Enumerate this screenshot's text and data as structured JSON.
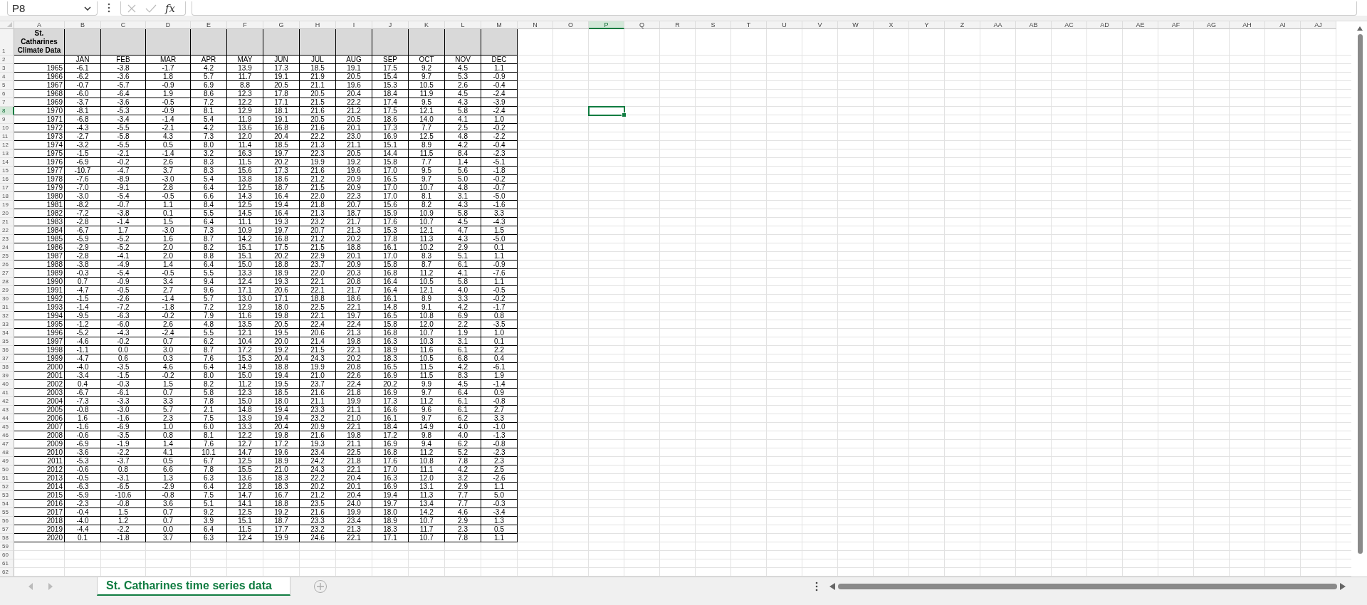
{
  "formula_bar": {
    "name_box": "P8",
    "function_label": "fx"
  },
  "columns": [
    {
      "label": "A",
      "selected": false
    },
    {
      "label": "B",
      "selected": false
    },
    {
      "label": "C",
      "selected": false
    },
    {
      "label": "D",
      "selected": false
    },
    {
      "label": "E",
      "selected": false
    },
    {
      "label": "F",
      "selected": false
    },
    {
      "label": "G",
      "selected": false
    },
    {
      "label": "H",
      "selected": false
    },
    {
      "label": "I",
      "selected": false
    },
    {
      "label": "J",
      "selected": false
    },
    {
      "label": "K",
      "selected": false
    },
    {
      "label": "L",
      "selected": false
    },
    {
      "label": "M",
      "selected": false
    },
    {
      "label": "N",
      "selected": false
    },
    {
      "label": "O",
      "selected": false
    },
    {
      "label": "P",
      "selected": true
    },
    {
      "label": "Q",
      "selected": false
    },
    {
      "label": "R",
      "selected": false
    },
    {
      "label": "S",
      "selected": false
    },
    {
      "label": "T",
      "selected": false
    },
    {
      "label": "U",
      "selected": false
    },
    {
      "label": "V",
      "selected": false
    },
    {
      "label": "W",
      "selected": false
    },
    {
      "label": "X",
      "selected": false
    },
    {
      "label": "Y",
      "selected": false
    },
    {
      "label": "Z",
      "selected": false
    },
    {
      "label": "AA",
      "selected": false
    },
    {
      "label": "AB",
      "selected": false
    },
    {
      "label": "AC",
      "selected": false
    },
    {
      "label": "AD",
      "selected": false
    },
    {
      "label": "AE",
      "selected": false
    },
    {
      "label": "AF",
      "selected": false
    },
    {
      "label": "AG",
      "selected": false
    },
    {
      "label": "AH",
      "selected": false
    },
    {
      "label": "AI",
      "selected": false
    },
    {
      "label": "AJ",
      "selected": false
    }
  ],
  "row_headers": [
    {
      "label": "1",
      "selected": false
    },
    {
      "label": "2",
      "selected": false
    },
    {
      "label": "3",
      "selected": false
    },
    {
      "label": "4",
      "selected": false
    },
    {
      "label": "5",
      "selected": false
    },
    {
      "label": "6",
      "selected": false
    },
    {
      "label": "7",
      "selected": false
    },
    {
      "label": "8",
      "selected": true
    },
    {
      "label": "9",
      "selected": false
    },
    {
      "label": "10",
      "selected": false
    },
    {
      "label": "11",
      "selected": false
    },
    {
      "label": "12",
      "selected": false
    },
    {
      "label": "13",
      "selected": false
    },
    {
      "label": "14",
      "selected": false
    },
    {
      "label": "15",
      "selected": false
    },
    {
      "label": "16",
      "selected": false
    },
    {
      "label": "17",
      "selected": false
    },
    {
      "label": "18",
      "selected": false
    },
    {
      "label": "19",
      "selected": false
    },
    {
      "label": "20",
      "selected": false
    },
    {
      "label": "21",
      "selected": false
    },
    {
      "label": "22",
      "selected": false
    },
    {
      "label": "23",
      "selected": false
    },
    {
      "label": "24",
      "selected": false
    },
    {
      "label": "25",
      "selected": false
    },
    {
      "label": "26",
      "selected": false
    },
    {
      "label": "27",
      "selected": false
    },
    {
      "label": "28",
      "selected": false
    },
    {
      "label": "29",
      "selected": false
    },
    {
      "label": "30",
      "selected": false
    },
    {
      "label": "31",
      "selected": false
    },
    {
      "label": "32",
      "selected": false
    },
    {
      "label": "33",
      "selected": false
    },
    {
      "label": "34",
      "selected": false
    },
    {
      "label": "35",
      "selected": false
    },
    {
      "label": "36",
      "selected": false
    },
    {
      "label": "37",
      "selected": false
    },
    {
      "label": "38",
      "selected": false
    },
    {
      "label": "39",
      "selected": false
    },
    {
      "label": "40",
      "selected": false
    },
    {
      "label": "41",
      "selected": false
    },
    {
      "label": "42",
      "selected": false
    },
    {
      "label": "43",
      "selected": false
    },
    {
      "label": "44",
      "selected": false
    },
    {
      "label": "45",
      "selected": false
    },
    {
      "label": "46",
      "selected": false
    },
    {
      "label": "47",
      "selected": false
    },
    {
      "label": "48",
      "selected": false
    },
    {
      "label": "49",
      "selected": false
    },
    {
      "label": "50",
      "selected": false
    },
    {
      "label": "51",
      "selected": false
    },
    {
      "label": "52",
      "selected": false
    },
    {
      "label": "53",
      "selected": false
    },
    {
      "label": "54",
      "selected": false
    },
    {
      "label": "55",
      "selected": false
    },
    {
      "label": "56",
      "selected": false
    },
    {
      "label": "57",
      "selected": false
    },
    {
      "label": "58",
      "selected": false
    },
    {
      "label": "59",
      "selected": false
    },
    {
      "label": "60",
      "selected": false
    },
    {
      "label": "61",
      "selected": false
    },
    {
      "label": "62",
      "selected": false
    }
  ],
  "table": {
    "title": "St. Catharines Climate Data",
    "months": [
      "JAN",
      "FEB",
      "MAR",
      "APR",
      "MAY",
      "JUN",
      "JUL",
      "AUG",
      "SEP",
      "OCT",
      "NOV",
      "DEC"
    ],
    "rows": [
      {
        "year": "1965",
        "values": [
          "-6.1",
          "-3.8",
          "-1.7",
          "4.2",
          "13.9",
          "17.3",
          "18.5",
          "19.1",
          "17.5",
          "9.2",
          "4.5",
          "1.1"
        ]
      },
      {
        "year": "1966",
        "values": [
          "-6.2",
          "-3.6",
          "1.8",
          "5.7",
          "11.7",
          "19.1",
          "21.9",
          "20.5",
          "15.4",
          "9.7",
          "5.3",
          "-0.9"
        ]
      },
      {
        "year": "1967",
        "values": [
          "-0.7",
          "-5.7",
          "-0.9",
          "6.9",
          "8.8",
          "20.5",
          "21.1",
          "19.6",
          "15.3",
          "10.5",
          "2.6",
          "-0.4"
        ]
      },
      {
        "year": "1968",
        "values": [
          "-6.0",
          "-6.4",
          "1.9",
          "8.6",
          "12.3",
          "17.8",
          "20.5",
          "20.4",
          "18.4",
          "11.9",
          "4.5",
          "-2.4"
        ]
      },
      {
        "year": "1969",
        "values": [
          "-3.7",
          "-3.6",
          "-0.5",
          "7.2",
          "12.2",
          "17.1",
          "21.5",
          "22.2",
          "17.4",
          "9.5",
          "4.3",
          "-3.9"
        ]
      },
      {
        "year": "1970",
        "values": [
          "-8.1",
          "-5.3",
          "-0.9",
          "8.1",
          "12.9",
          "18.1",
          "21.6",
          "21.2",
          "17.5",
          "12.1",
          "5.8",
          "-2.4"
        ]
      },
      {
        "year": "1971",
        "values": [
          "-6.8",
          "-3.4",
          "-1.4",
          "5.4",
          "11.9",
          "19.1",
          "20.5",
          "20.5",
          "18.6",
          "14.0",
          "4.1",
          "1.0"
        ]
      },
      {
        "year": "1972",
        "values": [
          "-4.3",
          "-5.5",
          "-2.1",
          "4.2",
          "13.6",
          "16.8",
          "21.6",
          "20.1",
          "17.3",
          "7.7",
          "2.5",
          "-0.2"
        ]
      },
      {
        "year": "1973",
        "values": [
          "-2.7",
          "-5.8",
          "4.3",
          "7.3",
          "12.0",
          "20.4",
          "22.2",
          "23.0",
          "16.9",
          "12.5",
          "4.8",
          "-2.2"
        ]
      },
      {
        "year": "1974",
        "values": [
          "-3.2",
          "-5.5",
          "0.5",
          "8.0",
          "11.4",
          "18.5",
          "21.3",
          "21.1",
          "15.1",
          "8.9",
          "4.2",
          "-0.4"
        ]
      },
      {
        "year": "1975",
        "values": [
          "-1.5",
          "-2.1",
          "-1.4",
          "3.2",
          "16.3",
          "19.7",
          "22.3",
          "20.5",
          "14.4",
          "11.5",
          "8.4",
          "-2.3"
        ]
      },
      {
        "year": "1976",
        "values": [
          "-6.9",
          "-0.2",
          "2.6",
          "8.3",
          "11.5",
          "20.2",
          "19.9",
          "19.2",
          "15.8",
          "7.7",
          "1.4",
          "-5.1"
        ]
      },
      {
        "year": "1977",
        "values": [
          "-10.7",
          "-4.7",
          "3.7",
          "8.3",
          "15.6",
          "17.3",
          "21.6",
          "19.6",
          "17.0",
          "9.5",
          "5.6",
          "-1.8"
        ]
      },
      {
        "year": "1978",
        "values": [
          "-7.6",
          "-8.9",
          "-3.0",
          "5.4",
          "13.8",
          "18.6",
          "21.2",
          "20.9",
          "16.5",
          "9.7",
          "5.0",
          "-0.2"
        ]
      },
      {
        "year": "1979",
        "values": [
          "-7.0",
          "-9.1",
          "2.8",
          "6.4",
          "12.5",
          "18.7",
          "21.5",
          "20.9",
          "17.0",
          "10.7",
          "4.8",
          "-0.7"
        ]
      },
      {
        "year": "1980",
        "values": [
          "-3.0",
          "-5.4",
          "-0.5",
          "6.6",
          "14.3",
          "16.4",
          "22.0",
          "22.3",
          "17.0",
          "8.1",
          "3.1",
          "-5.0"
        ]
      },
      {
        "year": "1981",
        "values": [
          "-8.2",
          "-0.7",
          "1.1",
          "8.4",
          "12.5",
          "19.4",
          "21.8",
          "20.7",
          "15.6",
          "8.2",
          "4.3",
          "-1.6"
        ]
      },
      {
        "year": "1982",
        "values": [
          "-7.2",
          "-3.8",
          "0.1",
          "5.5",
          "14.5",
          "16.4",
          "21.3",
          "18.7",
          "15.9",
          "10.9",
          "5.8",
          "3.3"
        ]
      },
      {
        "year": "1983",
        "values": [
          "-2.8",
          "-1.4",
          "1.5",
          "6.4",
          "11.1",
          "19.3",
          "23.2",
          "21.7",
          "17.6",
          "10.7",
          "4.5",
          "-4.3"
        ]
      },
      {
        "year": "1984",
        "values": [
          "-6.7",
          "1.7",
          "-3.0",
          "7.3",
          "10.9",
          "19.7",
          "20.7",
          "21.3",
          "15.3",
          "12.1",
          "4.7",
          "1.5"
        ]
      },
      {
        "year": "1985",
        "values": [
          "-5.9",
          "-5.2",
          "1.6",
          "8.7",
          "14.2",
          "16.8",
          "21.2",
          "20.2",
          "17.8",
          "11.3",
          "4.3",
          "-5.0"
        ]
      },
      {
        "year": "1986",
        "values": [
          "-2.9",
          "-5.2",
          "2.0",
          "8.2",
          "15.1",
          "17.5",
          "21.5",
          "18.8",
          "16.1",
          "10.2",
          "2.9",
          "0.1"
        ]
      },
      {
        "year": "1987",
        "values": [
          "-2.8",
          "-4.1",
          "2.0",
          "8.8",
          "15.1",
          "20.2",
          "22.9",
          "20.1",
          "17.0",
          "8.3",
          "5.1",
          "1.1"
        ]
      },
      {
        "year": "1988",
        "values": [
          "-3.8",
          "-4.9",
          "1.4",
          "6.4",
          "15.0",
          "18.8",
          "23.7",
          "20.9",
          "15.8",
          "8.7",
          "6.1",
          "-0.9"
        ]
      },
      {
        "year": "1989",
        "values": [
          "-0.3",
          "-5.4",
          "-0.5",
          "5.5",
          "13.3",
          "18.9",
          "22.0",
          "20.3",
          "16.8",
          "11.2",
          "4.1",
          "-7.6"
        ]
      },
      {
        "year": "1990",
        "values": [
          "0.7",
          "-0.9",
          "3.4",
          "9.4",
          "12.4",
          "19.3",
          "22.1",
          "20.8",
          "16.4",
          "10.5",
          "5.8",
          "1.1"
        ]
      },
      {
        "year": "1991",
        "values": [
          "-4.7",
          "-0.5",
          "2.7",
          "9.6",
          "17.1",
          "20.6",
          "22.1",
          "21.7",
          "16.4",
          "12.1",
          "4.0",
          "-0.5"
        ]
      },
      {
        "year": "1992",
        "values": [
          "-1.5",
          "-2.6",
          "-1.4",
          "5.7",
          "13.0",
          "17.1",
          "18.8",
          "18.6",
          "16.1",
          "8.9",
          "3.3",
          "-0.2"
        ]
      },
      {
        "year": "1993",
        "values": [
          "-1.4",
          "-7.2",
          "-1.8",
          "7.2",
          "12.9",
          "18.0",
          "22.5",
          "22.1",
          "14.8",
          "9.1",
          "4.2",
          "-1.7"
        ]
      },
      {
        "year": "1994",
        "values": [
          "-9.5",
          "-6.3",
          "-0.2",
          "7.9",
          "11.6",
          "19.8",
          "22.1",
          "19.7",
          "16.5",
          "10.8",
          "6.9",
          "0.8"
        ]
      },
      {
        "year": "1995",
        "values": [
          "-1.2",
          "-6.0",
          "2.6",
          "4.8",
          "13.5",
          "20.5",
          "22.4",
          "22.4",
          "15.8",
          "12.0",
          "2.2",
          "-3.5"
        ]
      },
      {
        "year": "1996",
        "values": [
          "-5.2",
          "-4.3",
          "-2.4",
          "5.5",
          "12.1",
          "19.5",
          "20.6",
          "21.3",
          "16.8",
          "10.7",
          "1.9",
          "1.0"
        ]
      },
      {
        "year": "1997",
        "values": [
          "-4.6",
          "-0.2",
          "0.7",
          "6.2",
          "10.4",
          "20.0",
          "21.4",
          "19.8",
          "16.3",
          "10.3",
          "3.1",
          "0.1"
        ]
      },
      {
        "year": "1998",
        "values": [
          "-1.1",
          "0.0",
          "3.0",
          "8.7",
          "17.2",
          "19.2",
          "21.5",
          "22.1",
          "18.9",
          "11.6",
          "6.1",
          "2.2"
        ]
      },
      {
        "year": "1999",
        "values": [
          "-4.7",
          "0.6",
          "0.3",
          "7.6",
          "15.3",
          "20.4",
          "24.3",
          "20.2",
          "18.3",
          "10.5",
          "6.8",
          "0.4"
        ]
      },
      {
        "year": "2000",
        "values": [
          "-4.0",
          "-3.5",
          "4.6",
          "6.4",
          "14.9",
          "18.8",
          "19.9",
          "20.8",
          "16.5",
          "11.5",
          "4.2",
          "-6.1"
        ]
      },
      {
        "year": "2001",
        "values": [
          "-3.4",
          "-1.5",
          "-0.2",
          "8.0",
          "15.0",
          "19.4",
          "21.0",
          "22.6",
          "16.9",
          "11.5",
          "8.3",
          "1.9"
        ]
      },
      {
        "year": "2002",
        "values": [
          "0.4",
          "-0.3",
          "1.5",
          "8.2",
          "11.2",
          "19.5",
          "23.7",
          "22.4",
          "20.2",
          "9.9",
          "4.5",
          "-1.4"
        ]
      },
      {
        "year": "2003",
        "values": [
          "-6.7",
          "-6.1",
          "0.7",
          "5.8",
          "12.3",
          "18.5",
          "21.6",
          "21.8",
          "16.9",
          "9.7",
          "6.4",
          "0.9"
        ]
      },
      {
        "year": "2004",
        "values": [
          "-7.3",
          "-3.3",
          "3.3",
          "7.8",
          "15.0",
          "18.0",
          "21.1",
          "19.9",
          "17.3",
          "11.2",
          "6.1",
          "-0.8"
        ]
      },
      {
        "year": "2005",
        "values": [
          "-0.8",
          "-3.0",
          "5.7",
          "2.1",
          "14.8",
          "19.4",
          "23.3",
          "21.1",
          "16.6",
          "9.6",
          "6.1",
          "2.7"
        ]
      },
      {
        "year": "2006",
        "values": [
          "1.6",
          "-1.6",
          "2.3",
          "7.5",
          "13.9",
          "19.4",
          "23.2",
          "21.0",
          "16.1",
          "9.7",
          "6.2",
          "3.3"
        ]
      },
      {
        "year": "2007",
        "values": [
          "-1.6",
          "-6.9",
          "1.0",
          "6.0",
          "13.3",
          "20.4",
          "20.9",
          "22.1",
          "18.4",
          "14.9",
          "4.0",
          "-1.0"
        ]
      },
      {
        "year": "2008",
        "values": [
          "-0.6",
          "-3.5",
          "0.8",
          "8.1",
          "12.2",
          "19.8",
          "21.6",
          "19.8",
          "17.2",
          "9.8",
          "4.0",
          "-1.3"
        ]
      },
      {
        "year": "2009",
        "values": [
          "-6.9",
          "-1.9",
          "1.4",
          "7.6",
          "12.7",
          "17.2",
          "19.3",
          "21.1",
          "16.9",
          "9.4",
          "6.2",
          "-0.8"
        ]
      },
      {
        "year": "2010",
        "values": [
          "-3.6",
          "-2.2",
          "4.1",
          "10.1",
          "14.7",
          "19.6",
          "23.4",
          "22.5",
          "16.8",
          "11.2",
          "5.2",
          "-2.3"
        ]
      },
      {
        "year": "2011",
        "values": [
          "-5.3",
          "-3.7",
          "0.5",
          "6.7",
          "12.5",
          "18.9",
          "24.2",
          "21.8",
          "17.6",
          "10.8",
          "7.8",
          "2.3"
        ]
      },
      {
        "year": "2012",
        "values": [
          "-0.6",
          "0.8",
          "6.6",
          "7.8",
          "15.5",
          "21.0",
          "24.3",
          "22.1",
          "17.0",
          "11.1",
          "4.2",
          "2.5"
        ]
      },
      {
        "year": "2013",
        "values": [
          "-0.5",
          "-3.1",
          "1.3",
          "6.3",
          "13.6",
          "18.3",
          "22.2",
          "20.4",
          "16.3",
          "12.0",
          "3.2",
          "-2.6"
        ]
      },
      {
        "year": "2014",
        "values": [
          "-6.3",
          "-6.5",
          "-2.9",
          "6.4",
          "12.8",
          "18.3",
          "20.2",
          "20.1",
          "16.9",
          "13.1",
          "2.9",
          "1.1"
        ]
      },
      {
        "year": "2015",
        "values": [
          "-5.9",
          "-10.6",
          "-0.8",
          "7.5",
          "14.7",
          "16.7",
          "21.2",
          "20.4",
          "19.4",
          "11.3",
          "7.7",
          "5.0"
        ]
      },
      {
        "year": "2016",
        "values": [
          "-2.3",
          "-0.8",
          "3.6",
          "5.1",
          "14.1",
          "18.8",
          "23.5",
          "24.0",
          "19.7",
          "13.4",
          "7.7",
          "-0.3"
        ]
      },
      {
        "year": "2017",
        "values": [
          "-0.4",
          "1.5",
          "0.7",
          "9.2",
          "12.5",
          "19.2",
          "21.6",
          "19.9",
          "18.0",
          "14.2",
          "4.6",
          "-3.4"
        ]
      },
      {
        "year": "2018",
        "values": [
          "-4.0",
          "1.2",
          "0.7",
          "3.9",
          "15.1",
          "18.7",
          "23.3",
          "23.4",
          "18.9",
          "10.7",
          "2.9",
          "1.3"
        ]
      },
      {
        "year": "2019",
        "values": [
          "-4.4",
          "-2.2",
          "0.0",
          "6.4",
          "11.5",
          "17.7",
          "23.2",
          "21.3",
          "18.3",
          "11.7",
          "2.3",
          "0.5"
        ]
      },
      {
        "year": "2020",
        "values": [
          "0.1",
          "-1.8",
          "3.7",
          "6.3",
          "12.4",
          "19.9",
          "24.6",
          "22.1",
          "17.1",
          "10.7",
          "7.8",
          "1.1"
        ]
      }
    ]
  },
  "sheet_tabs": [
    {
      "label": "St. Catharines time series data",
      "selected": true
    }
  ]
}
